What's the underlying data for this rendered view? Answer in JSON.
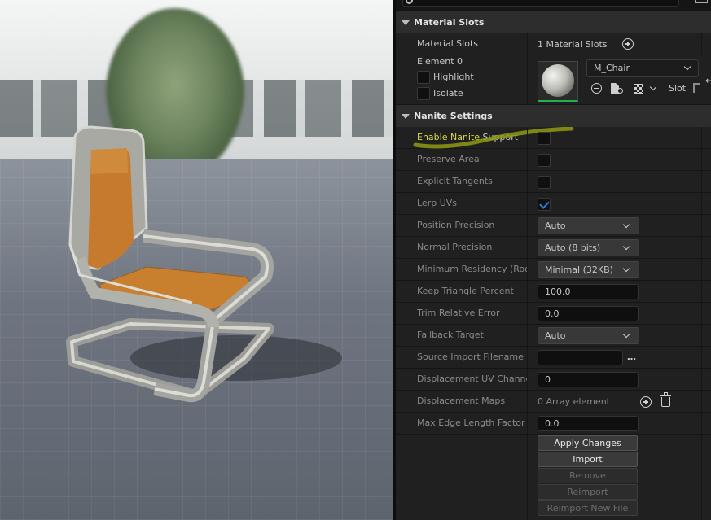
{
  "material_slots_section": {
    "title": "Material Slots",
    "row_label": "Material Slots",
    "count_text": "1 Material Slots",
    "element": {
      "label": "Element 0",
      "highlight_label": "Highlight",
      "isolate_label": "Isolate",
      "material_name": "M_Chair",
      "slot_label": "Slot"
    }
  },
  "nanite_section": {
    "title": "Nanite Settings",
    "enable_label_part1": "Enable Nanite",
    "enable_label_part2": " Support",
    "rows": {
      "preserve_area": {
        "label": "Preserve Area",
        "checked": false
      },
      "explicit_tangents": {
        "label": "Explicit Tangents",
        "checked": false
      },
      "lerp_uvs": {
        "label": "Lerp UVs",
        "checked": true
      },
      "position_precision": {
        "label": "Position Precision",
        "value": "Auto"
      },
      "normal_precision": {
        "label": "Normal Precision",
        "value": "Auto (8 bits)"
      },
      "minimum_residency": {
        "label": "Minimum Residency (Root",
        "value": "Minimal (32KB)"
      },
      "keep_triangle_percent": {
        "label": "Keep Triangle Percent",
        "value": "100.0"
      },
      "trim_relative_error": {
        "label": "Trim Relative Error",
        "value": "0.0"
      },
      "fallback_target": {
        "label": "Fallback Target",
        "value": "Auto"
      },
      "source_import_filename": {
        "label": "Source Import Filename",
        "value": ""
      },
      "displacement_uv_channel": {
        "label": "Displacement UV Channel",
        "value": "0"
      },
      "displacement_maps": {
        "label": "Displacement Maps",
        "value": "0 Array element"
      },
      "max_edge_length_factor": {
        "label": "Max Edge Length Factor",
        "value": "0.0"
      }
    },
    "buttons": {
      "apply_changes": "Apply Changes",
      "import": "Import",
      "remove": "Remove",
      "reimport": "Reimport",
      "reimport_new_file": "Reimport New File"
    }
  },
  "colors": {
    "highlight_underline": "#d4e21a",
    "enable_label_color": "#d9d94a",
    "check_blue": "#2b7bd6",
    "chair_leather": "#c67a2e",
    "chair_frame": "#b9b9b4"
  }
}
